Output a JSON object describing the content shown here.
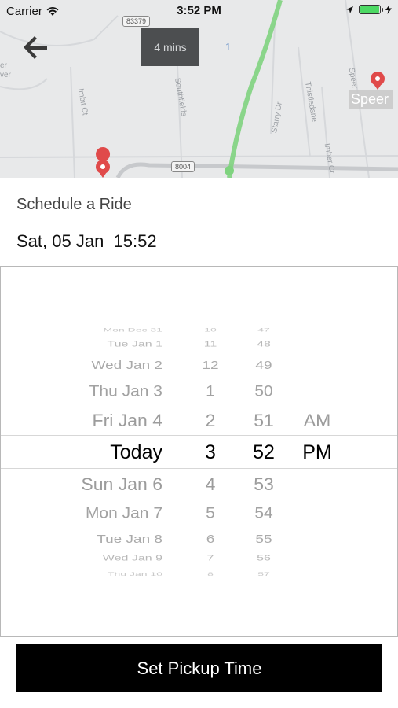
{
  "status_bar": {
    "carrier": "Carrier",
    "time": "3:52 PM"
  },
  "map": {
    "eta": "4 mins",
    "badge_number": "1",
    "route_shields": [
      "83379",
      "8004"
    ],
    "street_labels": [
      "Imbit Ct",
      "Southfields",
      "Starry Dr",
      "Thistledane",
      "Imber Cr",
      "Speer"
    ],
    "edge_labels": [
      "er",
      "ver"
    ],
    "place_label": "Speer"
  },
  "schedule": {
    "title": "Schedule a Ride",
    "selected": "Sat, 05 Jan  15:52"
  },
  "picker": {
    "dates": [
      "Mon Dec 31",
      "Tue Jan 1",
      "Wed Jan 2",
      "Thu Jan 3",
      "Fri Jan 4",
      "Today",
      "Sun Jan 6",
      "Mon Jan 7",
      "Tue Jan 8",
      "Wed Jan 9",
      "Thu Jan 10"
    ],
    "hours": [
      "10",
      "11",
      "12",
      "1",
      "2",
      "3",
      "4",
      "5",
      "6",
      "7",
      "8"
    ],
    "minutes": [
      "47",
      "48",
      "49",
      "50",
      "51",
      "52",
      "53",
      "54",
      "55",
      "56",
      "57"
    ],
    "ampm": [
      "AM",
      "PM"
    ],
    "selected_index": 5
  },
  "action": {
    "button_label": "Set Pickup Time"
  },
  "colors": {
    "route": "#7fd37f",
    "pin": "#e04a4a",
    "button_bg": "#000000",
    "battery": "#4cd964"
  }
}
